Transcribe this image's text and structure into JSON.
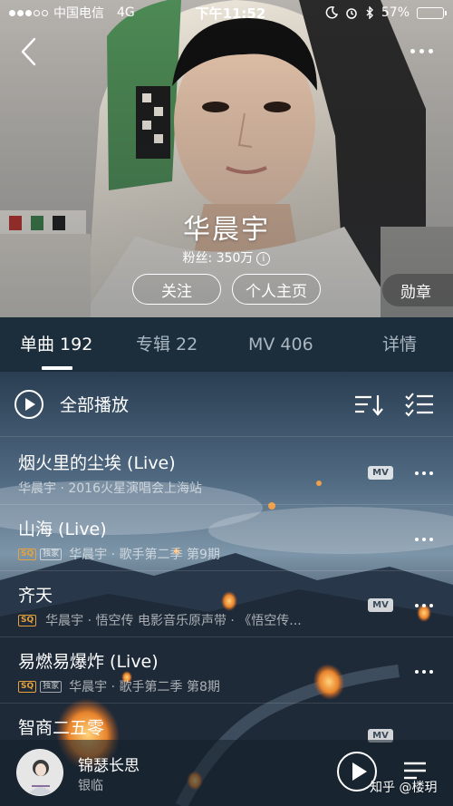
{
  "status_bar": {
    "carrier": "中国电信",
    "network": "4G",
    "time": "下午11:52",
    "battery": "57%",
    "battery_level": 0.57
  },
  "header": {
    "back_icon": "chevron-left-icon",
    "more_icon": "more-dots-icon"
  },
  "artist": {
    "name": "华晨宇",
    "fans": "粉丝: 350万",
    "follow_label": "关注",
    "homepage_label": "个人主页",
    "medal_label": "勋章"
  },
  "tabs": [
    {
      "label": "单曲 192",
      "active": true
    },
    {
      "label": "专辑 22",
      "active": false
    },
    {
      "label": "MV 406",
      "active": false
    },
    {
      "label": "详情",
      "active": false
    }
  ],
  "play_all": {
    "label": "全部播放",
    "sort_icon": "sort-icon",
    "multi_select_icon": "multi-select-icon"
  },
  "songs": [
    {
      "title": "烟火里的尘埃 (Live)",
      "meta": "华晨宇 · 2016火星演唱会上海站",
      "sq": false,
      "exclusive": false,
      "mv": true
    },
    {
      "title": "山海 (Live)",
      "meta": "华晨宇 · 歌手第二季 第9期",
      "sq": true,
      "exclusive": true,
      "mv": false
    },
    {
      "title": "齐天",
      "meta": "华晨宇 · 悟空传 电影音乐原声带 · 《悟空传...",
      "sq": true,
      "exclusive": false,
      "mv": true
    },
    {
      "title": "易燃易爆炸 (Live)",
      "meta": "华晨宇 · 歌手第二季 第8期",
      "sq": true,
      "exclusive": true,
      "mv": false
    },
    {
      "title": "智商二五零",
      "meta": "",
      "sq": false,
      "exclusive": false,
      "mv": true
    }
  ],
  "badges": {
    "sq": "SQ",
    "exclusive": "独家",
    "mv": "MV"
  },
  "player": {
    "title": "锦瑟长思",
    "artist": "银临",
    "watermark": "知乎 @楼玥"
  },
  "colors": {
    "tab_bar": "#1c2e3c",
    "sq_badge": "#e6a23c"
  }
}
